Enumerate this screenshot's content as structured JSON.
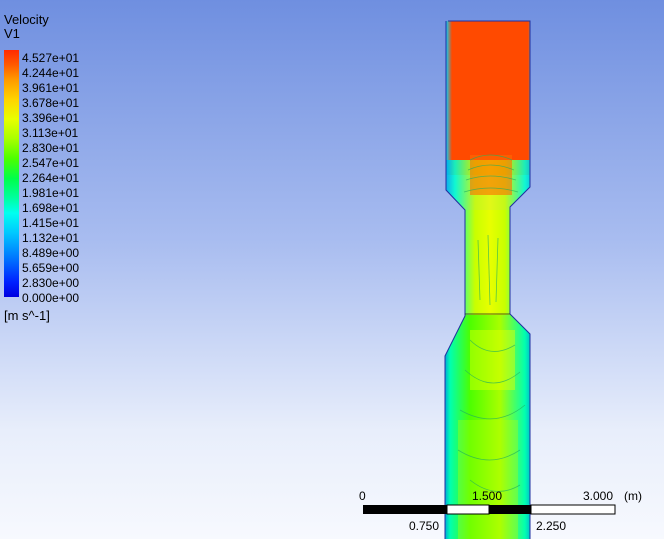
{
  "legend": {
    "title": "Velocity",
    "subtitle": "V1",
    "ticks": [
      "4.527e+01",
      "4.244e+01",
      "3.961e+01",
      "3.678e+01",
      "3.396e+01",
      "3.113e+01",
      "2.830e+01",
      "2.547e+01",
      "2.264e+01",
      "1.981e+01",
      "1.698e+01",
      "1.415e+01",
      "1.132e+01",
      "8.489e+00",
      "5.659e+00",
      "2.830e+00",
      "0.000e+00"
    ],
    "unit": "[m s^-1]"
  },
  "scale": {
    "top_labels": [
      "0",
      "1.500",
      "3.000"
    ],
    "unit": "(m)",
    "bottom_labels": [
      "0.750",
      "2.250"
    ]
  },
  "colors": {
    "max": "#ff4a00",
    "high": "#e8ff00",
    "mid": "#4cff00",
    "low_mid": "#00ffa0",
    "low": "#00c8ff",
    "min": "#0000e0"
  }
}
